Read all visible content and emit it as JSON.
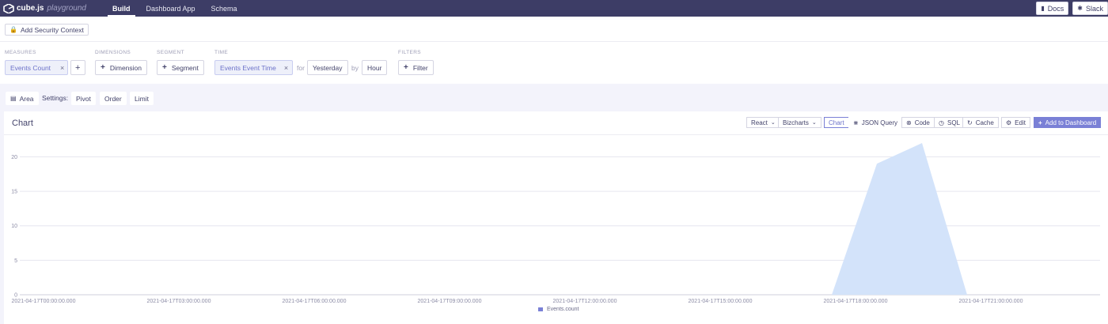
{
  "app": {
    "logo_word": "cube.js",
    "logo_sub": "playground",
    "nav": [
      "Build",
      "Dashboard App",
      "Schema"
    ],
    "active_nav": "Build",
    "docs_label": "Docs",
    "slack_label": "Slack"
  },
  "security": {
    "label": "Add Security Context"
  },
  "query": {
    "measures_label": "MEASURES",
    "measure_value": "Events Count",
    "dimensions_label": "DIMENSIONS",
    "dimension_add": "Dimension",
    "segment_label": "SEGMENT",
    "segment_add": "Segment",
    "time_label": "TIME",
    "time_value": "Events Event Time",
    "for_word": "for",
    "date_range": "Yesterday",
    "by_word": "by",
    "granularity": "Hour",
    "filters_label": "FILTERS",
    "filter_add": "Filter"
  },
  "settings": {
    "chart_type": "Area",
    "settings_label": "Settings:",
    "pivot": "Pivot",
    "order": "Order",
    "limit": "Limit"
  },
  "card": {
    "title": "Chart",
    "framework": "React",
    "library": "Bizcharts",
    "tabs": [
      "Chart",
      "JSON Query",
      "Code",
      "SQL",
      "Cache"
    ],
    "active_tab": "Chart",
    "edit": "Edit",
    "add_to_dashboard": "Add to Dashboard"
  },
  "colors": {
    "nav_bg": "#3d3d66",
    "accent": "#7a80d6",
    "area_fill": "#d3e3fa"
  },
  "chart_data": {
    "type": "area",
    "x": [
      "2021-04-17T00:00:00.000",
      "2021-04-17T01:00:00.000",
      "2021-04-17T02:00:00.000",
      "2021-04-17T03:00:00.000",
      "2021-04-17T04:00:00.000",
      "2021-04-17T05:00:00.000",
      "2021-04-17T06:00:00.000",
      "2021-04-17T07:00:00.000",
      "2021-04-17T08:00:00.000",
      "2021-04-17T09:00:00.000",
      "2021-04-17T10:00:00.000",
      "2021-04-17T11:00:00.000",
      "2021-04-17T12:00:00.000",
      "2021-04-17T13:00:00.000",
      "2021-04-17T14:00:00.000",
      "2021-04-17T15:00:00.000",
      "2021-04-17T16:00:00.000",
      "2021-04-17T17:00:00.000",
      "2021-04-17T18:00:00.000",
      "2021-04-17T19:00:00.000",
      "2021-04-17T20:00:00.000",
      "2021-04-17T21:00:00.000",
      "2021-04-17T22:00:00.000",
      "2021-04-17T23:00:00.000"
    ],
    "series": [
      {
        "name": "Events.count",
        "values": [
          0,
          0,
          0,
          0,
          0,
          0,
          0,
          0,
          0,
          0,
          0,
          0,
          0,
          0,
          0,
          0,
          0,
          0,
          0,
          19,
          22,
          0,
          0,
          0
        ]
      }
    ],
    "x_tick_labels": [
      "2021-04-17T00:00:00.000",
      "2021-04-17T03:00:00.000",
      "2021-04-17T06:00:00.000",
      "2021-04-17T09:00:00.000",
      "2021-04-17T12:00:00.000",
      "2021-04-17T15:00:00.000",
      "2021-04-17T18:00:00.000",
      "2021-04-17T21:00:00.000"
    ],
    "y_ticks": [
      0,
      5,
      10,
      15,
      20
    ],
    "ylim": [
      0,
      22
    ],
    "grid": true,
    "legend": "bottom-center"
  }
}
